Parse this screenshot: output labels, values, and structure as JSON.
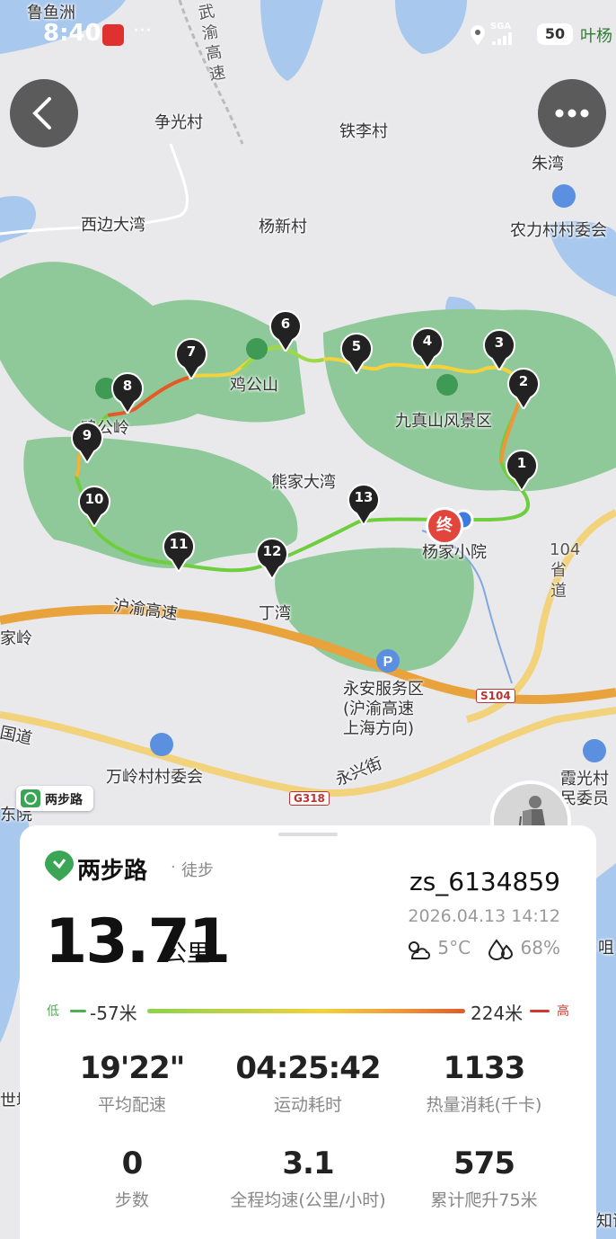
{
  "status_bar": {
    "time": "8:40",
    "network": "SGA",
    "battery": "50",
    "right_text": "叶杨"
  },
  "map": {
    "labels": {
      "zhengguang": "争光村",
      "tieli": "铁李村",
      "zhuwan": "朱湾",
      "nongli": "农力村村委会",
      "xibian": "西边大湾",
      "yangxin": "杨新村",
      "jigongshan": "鸡公山",
      "jiuzhenshan": "九真山风景区",
      "jigongling": "鸡公岭",
      "xiongjia": "熊家大湾",
      "yangjia": "杨家小院",
      "dingwan": "丁湾",
      "huyu_highway": "沪渝高速",
      "yongan": "永安服务区\n(沪渝高速\n上海方向)",
      "wanling": "万岭村村委会",
      "yongxing": "永兴街",
      "xiaguang": "霞光村\n民委员",
      "guodao": "国道",
      "jialing": "家岭",
      "dongyuan": "东院",
      "luyu": "鲁鱼洲",
      "zhiyi": "知语",
      "shiqu": "世城",
      "hu": "咀"
    },
    "vertical_labels": {
      "wuyu": "武渝高速",
      "provincial": "104省道"
    },
    "road_shields": {
      "s104": "S104",
      "g318": "G318"
    },
    "end_marker": "终",
    "markers": [
      "1",
      "2",
      "3",
      "4",
      "5",
      "6",
      "7",
      "8",
      "9",
      "10",
      "11",
      "12",
      "13"
    ]
  },
  "brand_tag": "两步路",
  "card": {
    "brand": "两步路",
    "separator": "·",
    "activity_type": "徒步",
    "distance": "13.71",
    "distance_unit": "公里",
    "username": "zs_6134859",
    "datetime": "2026.04.13 14:12",
    "temperature": "5°C",
    "humidity": "68%",
    "elevation": {
      "low_label": "低",
      "min": "-57米",
      "max": "224米",
      "high_label": "高"
    },
    "stats": [
      {
        "value": "19'22\"",
        "label": "平均配速"
      },
      {
        "value": "04:25:42",
        "label": "运动耗时"
      },
      {
        "value": "1133",
        "label": "热量消耗(千卡)"
      },
      {
        "value": "0",
        "label": "步数"
      },
      {
        "value": "3.1",
        "label": "全程均速(公里/小时)"
      },
      {
        "value": "575",
        "label": "累计爬升75米"
      }
    ]
  },
  "colors": {
    "park_green": "#8fc99a",
    "water_blue": "#a9c8ee",
    "highway_orange": "#e8a33d",
    "marker_dark": "#222222",
    "end_red": "#e2453c",
    "brand_green": "#3aa655"
  }
}
